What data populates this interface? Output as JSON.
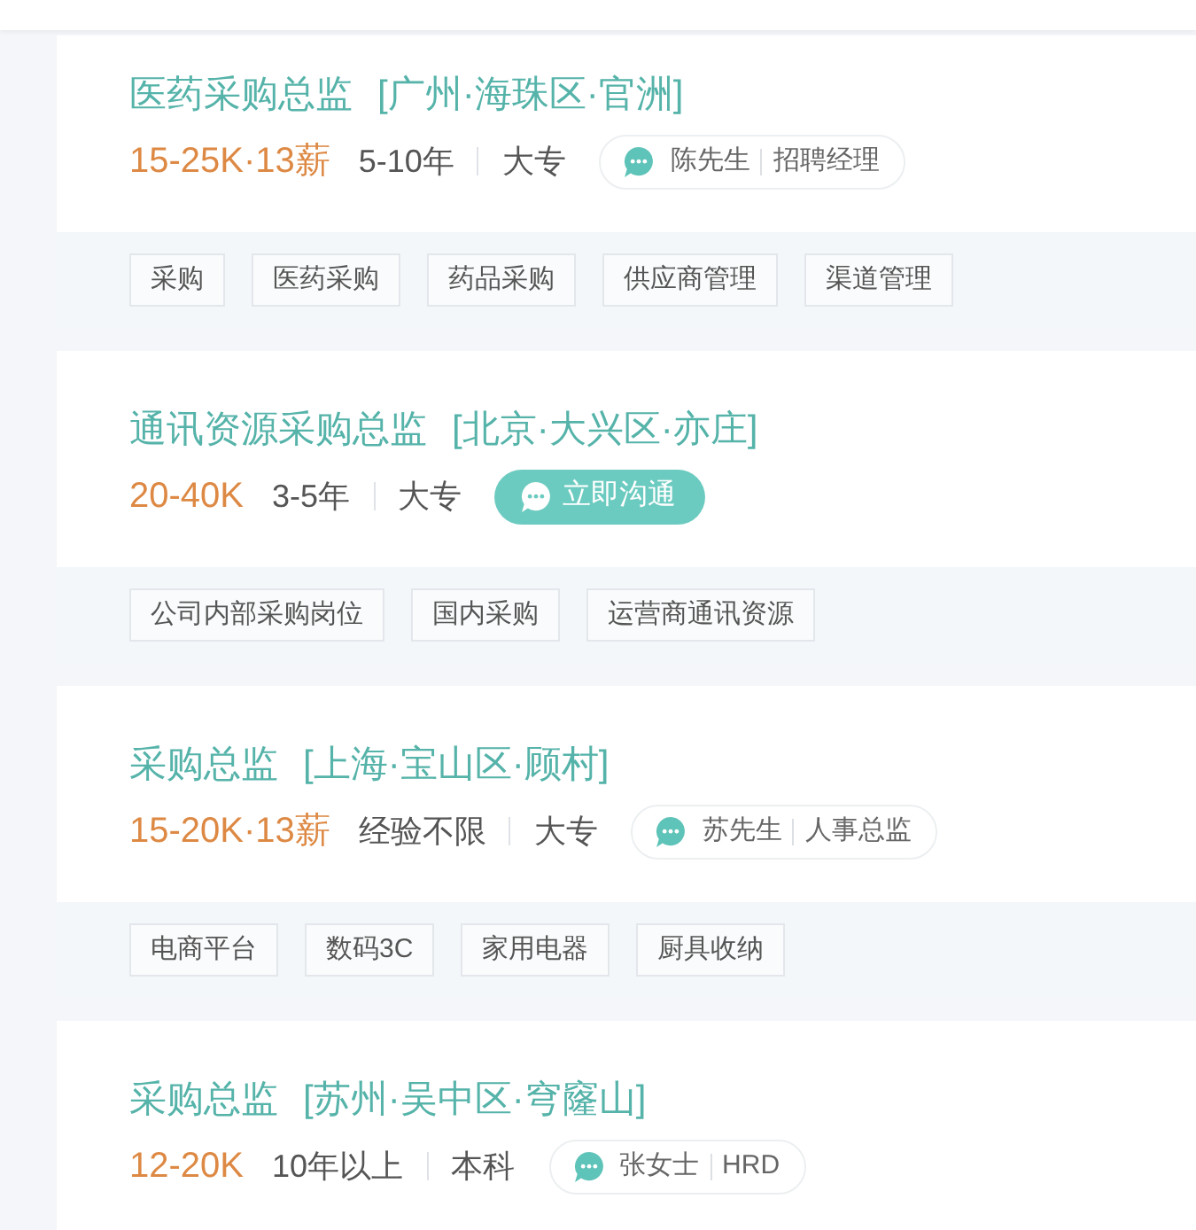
{
  "jobs": [
    {
      "title": "医药采购总监",
      "location": "[广州·海珠区·官洲]",
      "salary": "15-25K·13薪",
      "experience": "5-10年",
      "education": "大专",
      "contact": {
        "kind": "recruiter",
        "name": "陈先生",
        "role": "招聘经理"
      },
      "tags": [
        "采购",
        "医药采购",
        "药品采购",
        "供应商管理",
        "渠道管理"
      ]
    },
    {
      "title": "通讯资源采购总监",
      "location": "[北京·大兴区·亦庄]",
      "salary": "20-40K",
      "experience": "3-5年",
      "education": "大专",
      "contact": {
        "kind": "chat_button",
        "label": "立即沟通"
      },
      "tags": [
        "公司内部采购岗位",
        "国内采购",
        "运营商通讯资源"
      ]
    },
    {
      "title": "采购总监",
      "location": "[上海·宝山区·顾村]",
      "salary": "15-20K·13薪",
      "experience": "经验不限",
      "education": "大专",
      "contact": {
        "kind": "recruiter",
        "name": "苏先生",
        "role": "人事总监"
      },
      "tags": [
        "电商平台",
        "数码3C",
        "家用电器",
        "厨具收纳"
      ]
    },
    {
      "title": "采购总监",
      "location": "[苏州·吴中区·穹窿山]",
      "salary": "12-20K",
      "experience": "10年以上",
      "education": "本科",
      "contact": {
        "kind": "recruiter",
        "name": "张女士",
        "role": "HRD"
      }
    }
  ]
}
